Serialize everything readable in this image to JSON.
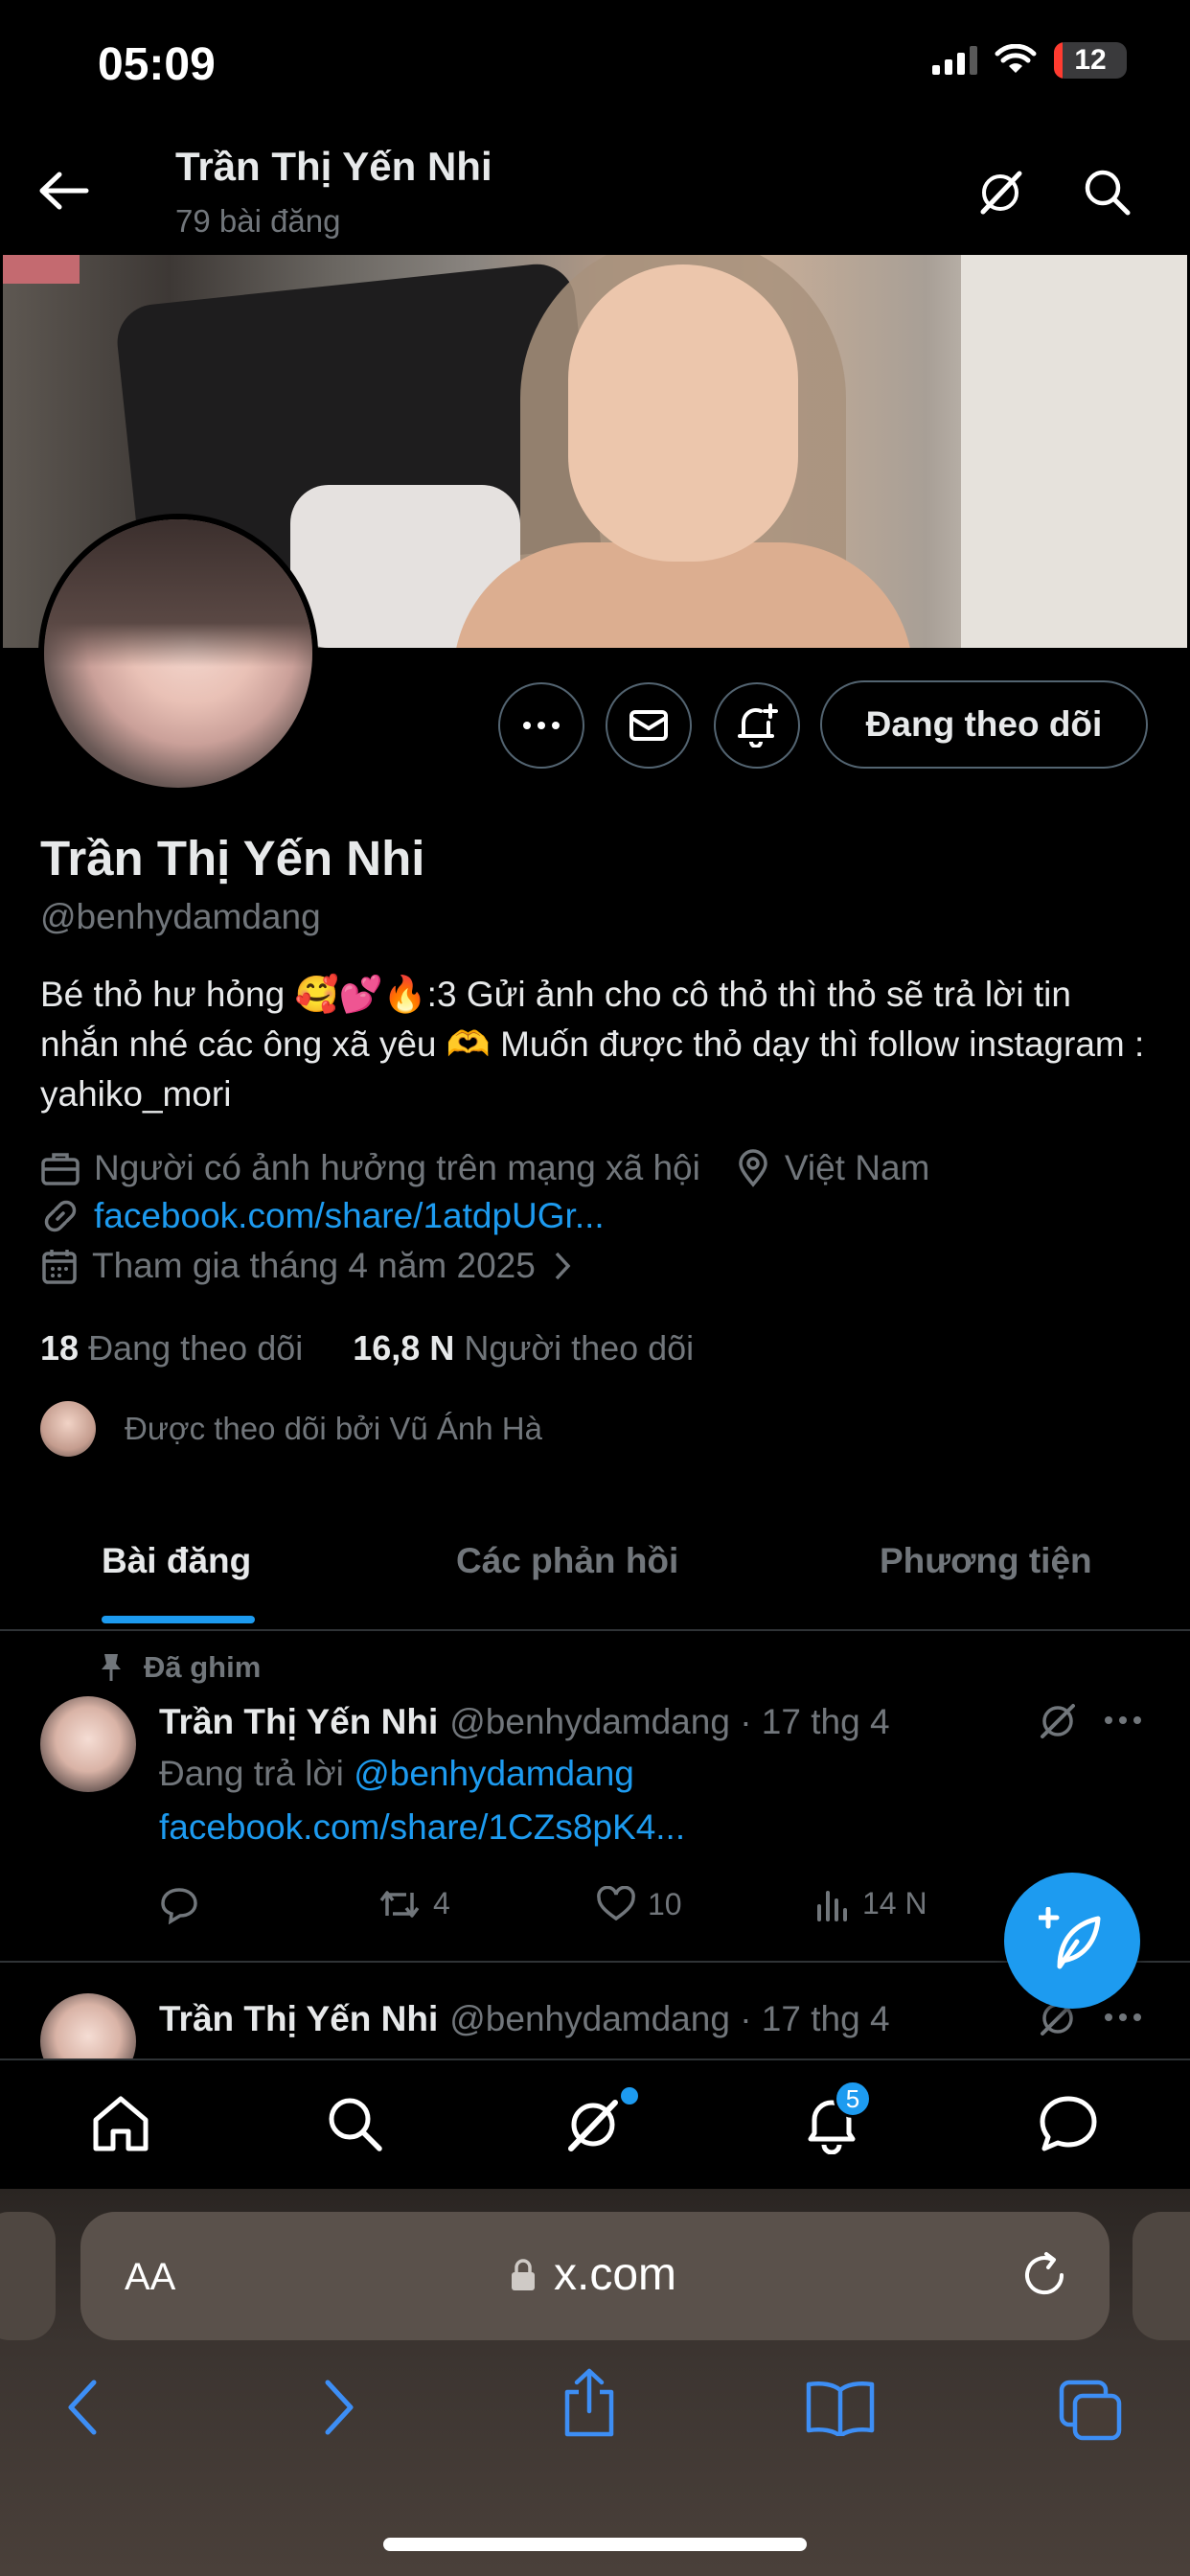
{
  "status_bar": {
    "time": "05:09",
    "battery": "12",
    "battery_level": 0.12
  },
  "header": {
    "title": "Trần Thị Yến Nhi",
    "post_count": "79 bài đăng"
  },
  "profile": {
    "name": "Trần Thị Yến Nhi",
    "handle": "@benhydamdang",
    "follow_button": "Đang theo dõi",
    "bio": "Bé thỏ hư hỏng 🥰💕🔥:3 Gửi ảnh cho cô thỏ thì thỏ sẽ trả lời tin nhắn nhé các ông xã yêu 🫶 Muốn được thỏ dạy thì follow instagram : yahiko_mori",
    "category": "Người có ảnh hưởng trên mạng xã hội",
    "location": "Việt Nam",
    "website": "facebook.com/share/1atdpUGr...",
    "joined": "Tham gia tháng 4 năm 2025",
    "following_count": "18",
    "following_label": "Đang theo dõi",
    "followers_count": "16,8 N",
    "followers_label": "Người theo dõi",
    "followed_by": "Được theo dõi bởi Vũ Ánh Hà"
  },
  "tabs": [
    {
      "label": "Bài đăng",
      "active": true
    },
    {
      "label": "Các phản hồi",
      "active": false
    },
    {
      "label": "Phương tiện",
      "active": false
    }
  ],
  "tweets": [
    {
      "pinned_label": "Đã ghim",
      "name": "Trần Thị Yến Nhi",
      "meta": "@benhydamdang · 17 thg 4",
      "reply_prefix": "Đang trả lời",
      "reply_to": "@benhydamdang",
      "link": "facebook.com/share/1CZs8pK4...",
      "retweets": "4",
      "likes": "10",
      "views": "14 N"
    },
    {
      "name": "Trần Thị Yến Nhi",
      "meta": "@benhydamdang · 17 thg 4"
    }
  ],
  "bottom_nav": {
    "notification_badge": "5"
  },
  "browser": {
    "aa": "AA",
    "url": "x.com"
  },
  "colors": {
    "accent": "#1d9bf0",
    "background": "#000000",
    "muted": "#71767b",
    "text": "#e7e9ea",
    "border": "#2f3336"
  },
  "icons": [
    "back-arrow-icon",
    "grok-icon",
    "search-icon",
    "more-icon",
    "mail-icon",
    "bell-plus-icon",
    "briefcase-icon",
    "location-icon",
    "link-icon",
    "calendar-icon",
    "chevron-right-icon",
    "pin-icon",
    "reply-icon",
    "retweet-icon",
    "heart-icon",
    "views-icon",
    "compose-icon",
    "home-icon",
    "bell-icon",
    "chat-icon",
    "lock-icon",
    "reload-icon",
    "share-icon",
    "bookmarks-icon",
    "tabs-icon"
  ]
}
